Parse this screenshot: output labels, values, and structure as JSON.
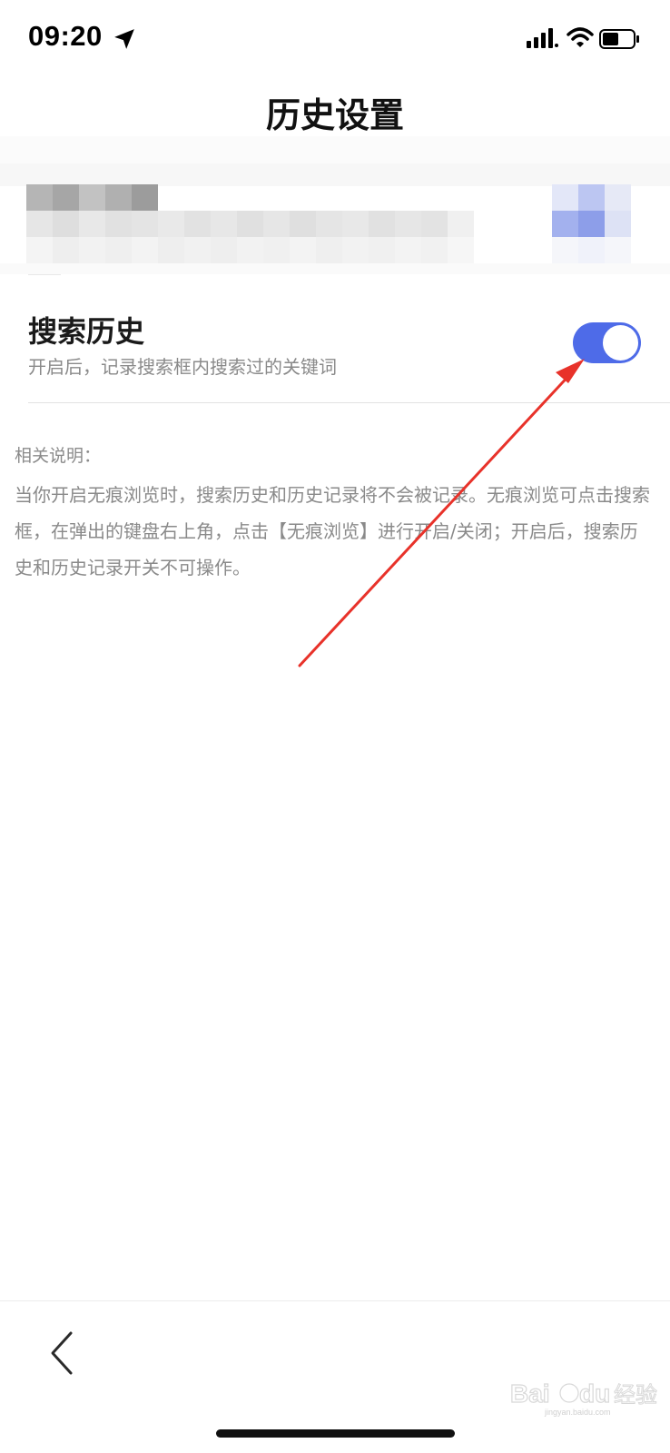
{
  "status_bar": {
    "time": "09:20",
    "icons": [
      "location-arrow-icon",
      "signal-icon",
      "wifi-icon",
      "battery-icon"
    ]
  },
  "header": {
    "title": "历史设置"
  },
  "blurred_account": {
    "note": ""
  },
  "search_history": {
    "title": "搜索历史",
    "description": "开启后，记录搜索框内搜索过的关键词",
    "enabled": true,
    "toggle_color": "#4e6be8"
  },
  "notes": {
    "heading": "相关说明：",
    "body": "当你开启无痕浏览时，搜索历史和历史记录将不会被记录。无痕浏览可点击搜索框，在弹出的键盘右上角，点击【无痕浏览】进行开启/关闭；开启后，搜索历史和历史记录开关不可操作。"
  },
  "annotation": {
    "color": "#e8322a"
  },
  "bottom_bar": {
    "back_icon": "chevron-left-icon"
  },
  "watermark": {
    "text": "Baidu经验",
    "subtext": "jingyan.baidu.com"
  }
}
